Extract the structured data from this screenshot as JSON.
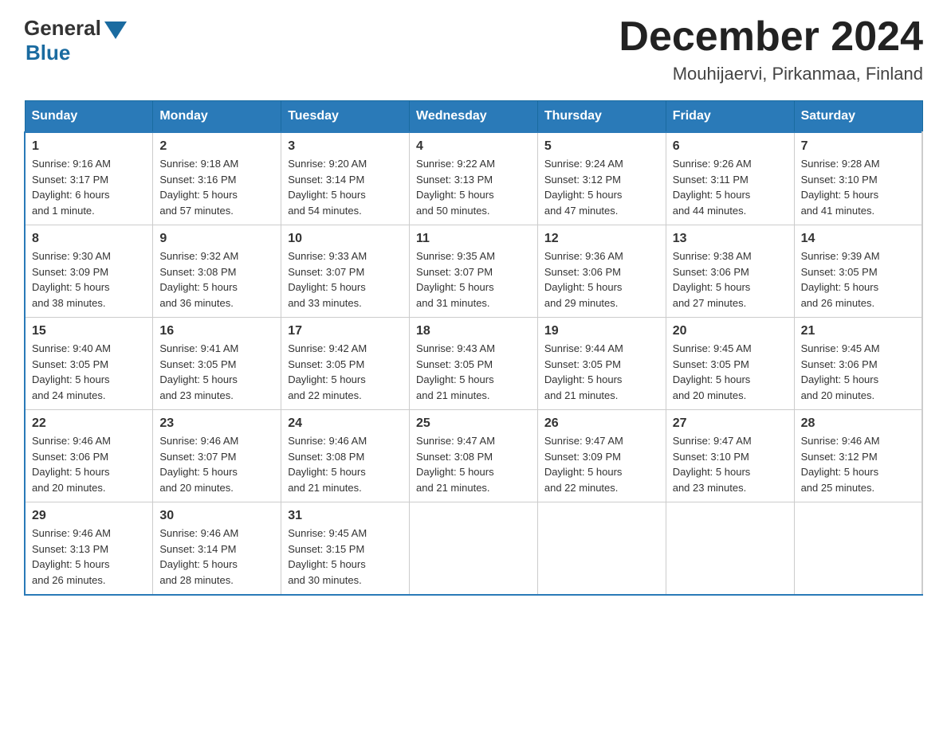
{
  "logo": {
    "general": "General",
    "blue": "Blue"
  },
  "title": "December 2024",
  "location": "Mouhijaervi, Pirkanmaa, Finland",
  "days_of_week": [
    "Sunday",
    "Monday",
    "Tuesday",
    "Wednesday",
    "Thursday",
    "Friday",
    "Saturday"
  ],
  "weeks": [
    [
      {
        "day": "1",
        "sunrise": "9:16 AM",
        "sunset": "3:17 PM",
        "daylight": "6 hours and 1 minute."
      },
      {
        "day": "2",
        "sunrise": "9:18 AM",
        "sunset": "3:16 PM",
        "daylight": "5 hours and 57 minutes."
      },
      {
        "day": "3",
        "sunrise": "9:20 AM",
        "sunset": "3:14 PM",
        "daylight": "5 hours and 54 minutes."
      },
      {
        "day": "4",
        "sunrise": "9:22 AM",
        "sunset": "3:13 PM",
        "daylight": "5 hours and 50 minutes."
      },
      {
        "day": "5",
        "sunrise": "9:24 AM",
        "sunset": "3:12 PM",
        "daylight": "5 hours and 47 minutes."
      },
      {
        "day": "6",
        "sunrise": "9:26 AM",
        "sunset": "3:11 PM",
        "daylight": "5 hours and 44 minutes."
      },
      {
        "day": "7",
        "sunrise": "9:28 AM",
        "sunset": "3:10 PM",
        "daylight": "5 hours and 41 minutes."
      }
    ],
    [
      {
        "day": "8",
        "sunrise": "9:30 AM",
        "sunset": "3:09 PM",
        "daylight": "5 hours and 38 minutes."
      },
      {
        "day": "9",
        "sunrise": "9:32 AM",
        "sunset": "3:08 PM",
        "daylight": "5 hours and 36 minutes."
      },
      {
        "day": "10",
        "sunrise": "9:33 AM",
        "sunset": "3:07 PM",
        "daylight": "5 hours and 33 minutes."
      },
      {
        "day": "11",
        "sunrise": "9:35 AM",
        "sunset": "3:07 PM",
        "daylight": "5 hours and 31 minutes."
      },
      {
        "day": "12",
        "sunrise": "9:36 AM",
        "sunset": "3:06 PM",
        "daylight": "5 hours and 29 minutes."
      },
      {
        "day": "13",
        "sunrise": "9:38 AM",
        "sunset": "3:06 PM",
        "daylight": "5 hours and 27 minutes."
      },
      {
        "day": "14",
        "sunrise": "9:39 AM",
        "sunset": "3:05 PM",
        "daylight": "5 hours and 26 minutes."
      }
    ],
    [
      {
        "day": "15",
        "sunrise": "9:40 AM",
        "sunset": "3:05 PM",
        "daylight": "5 hours and 24 minutes."
      },
      {
        "day": "16",
        "sunrise": "9:41 AM",
        "sunset": "3:05 PM",
        "daylight": "5 hours and 23 minutes."
      },
      {
        "day": "17",
        "sunrise": "9:42 AM",
        "sunset": "3:05 PM",
        "daylight": "5 hours and 22 minutes."
      },
      {
        "day": "18",
        "sunrise": "9:43 AM",
        "sunset": "3:05 PM",
        "daylight": "5 hours and 21 minutes."
      },
      {
        "day": "19",
        "sunrise": "9:44 AM",
        "sunset": "3:05 PM",
        "daylight": "5 hours and 21 minutes."
      },
      {
        "day": "20",
        "sunrise": "9:45 AM",
        "sunset": "3:05 PM",
        "daylight": "5 hours and 20 minutes."
      },
      {
        "day": "21",
        "sunrise": "9:45 AM",
        "sunset": "3:06 PM",
        "daylight": "5 hours and 20 minutes."
      }
    ],
    [
      {
        "day": "22",
        "sunrise": "9:46 AM",
        "sunset": "3:06 PM",
        "daylight": "5 hours and 20 minutes."
      },
      {
        "day": "23",
        "sunrise": "9:46 AM",
        "sunset": "3:07 PM",
        "daylight": "5 hours and 20 minutes."
      },
      {
        "day": "24",
        "sunrise": "9:46 AM",
        "sunset": "3:08 PM",
        "daylight": "5 hours and 21 minutes."
      },
      {
        "day": "25",
        "sunrise": "9:47 AM",
        "sunset": "3:08 PM",
        "daylight": "5 hours and 21 minutes."
      },
      {
        "day": "26",
        "sunrise": "9:47 AM",
        "sunset": "3:09 PM",
        "daylight": "5 hours and 22 minutes."
      },
      {
        "day": "27",
        "sunrise": "9:47 AM",
        "sunset": "3:10 PM",
        "daylight": "5 hours and 23 minutes."
      },
      {
        "day": "28",
        "sunrise": "9:46 AM",
        "sunset": "3:12 PM",
        "daylight": "5 hours and 25 minutes."
      }
    ],
    [
      {
        "day": "29",
        "sunrise": "9:46 AM",
        "sunset": "3:13 PM",
        "daylight": "5 hours and 26 minutes."
      },
      {
        "day": "30",
        "sunrise": "9:46 AM",
        "sunset": "3:14 PM",
        "daylight": "5 hours and 28 minutes."
      },
      {
        "day": "31",
        "sunrise": "9:45 AM",
        "sunset": "3:15 PM",
        "daylight": "5 hours and 30 minutes."
      },
      null,
      null,
      null,
      null
    ]
  ]
}
